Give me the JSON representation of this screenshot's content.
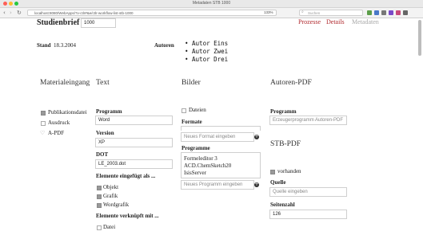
{
  "browser": {
    "window_title": "Metadaten STB 1000",
    "url": "localhost:8080/WebApps/?v-ctlr#&e/ctlr-workflow-list-stb-1000",
    "zoom": "133%",
    "search_placeholder": "Suchen",
    "back_label": "‹",
    "forward_label": "›",
    "reload_label": "↻",
    "traffic_colors": [
      "#ff5f57",
      "#febc2e",
      "#28c840"
    ]
  },
  "header": {
    "title_label": "Studienbrief",
    "title_value": "1000",
    "tabs": [
      "Prozesse",
      "Details",
      "Metadaten"
    ],
    "tab_colors": [
      "#b0282d",
      "#b0282d",
      "#a8a8a8"
    ],
    "stand_label": "Stand",
    "stand_value": "18.3.2004",
    "autoren_label": "Autoren",
    "authors": [
      "Autor Eins",
      "Autor Zwei",
      "Autor Drei"
    ]
  },
  "materialeingang": {
    "heading": "Materialeingang",
    "items": [
      {
        "label": "Publikationsdatei",
        "checked": true
      },
      {
        "label": "Ausdruck",
        "checked": false
      },
      {
        "label": "A-PDF",
        "checked": false
      }
    ]
  },
  "text": {
    "heading": "Text",
    "programm_label": "Programm",
    "programm_value": "Word",
    "version_label": "Version",
    "version_value": "XP",
    "dot_label": "DOT",
    "dot_value": "LE_2003.dot",
    "eingefuegt_label": "Elemente eingefügt als ...",
    "eingefuegt_items": [
      {
        "label": "Objekt",
        "checked": true
      },
      {
        "label": "Grafik",
        "checked": true
      },
      {
        "label": "Wordgrafik",
        "checked": true
      }
    ],
    "verknuepft_label": "Elemente verknüpft mit ...",
    "verknuepft_items": [
      {
        "label": "Datei",
        "checked": false
      }
    ]
  },
  "bilder": {
    "heading": "Bilder",
    "dateien_label": "Dateien",
    "formate_label": "Formate",
    "formate_placeholder": "Neues Format eingeben",
    "programme_label": "Programme",
    "programme_list": [
      "Formeleditor 3",
      "ACD.ChemSketch20",
      "IsisServer"
    ],
    "programme_placeholder": "Neues Programm eingeben",
    "add_symbol": "+"
  },
  "autoren_pdf": {
    "heading": "Autoren-PDF",
    "programm_label": "Programm",
    "programm_placeholder": "Erzeugerprogramm Autoren-PDF"
  },
  "stb_pdf": {
    "heading": "STB-PDF",
    "vorhanden_label": "vorhanden",
    "vorhanden_checked": true,
    "quelle_label": "Quelle",
    "quelle_placeholder": "Quelle eingeben",
    "seitenzahl_label": "Seitenzahl",
    "seitenzahl_value": "126"
  }
}
